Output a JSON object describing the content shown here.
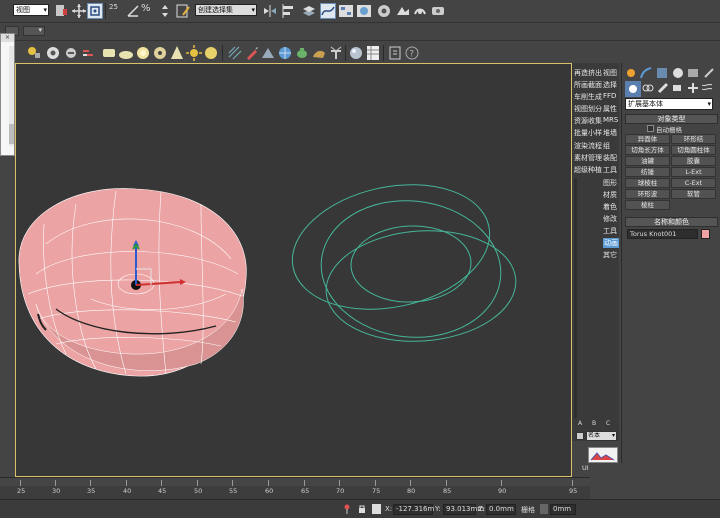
{
  "toolbar": {
    "view_dropdown": "视图",
    "selection_set": "创建选择集",
    "small_num": "25"
  },
  "scene_list": {
    "col1": [
      "再造挤出",
      "所画截面",
      "车削生成",
      "视图划分",
      "资源收集",
      "批量小样",
      "渲染流程",
      "素材管理",
      "超级种植"
    ],
    "col2": [
      "视图",
      "选择",
      "FFD",
      "属性",
      "MRS",
      "堆墙",
      "组",
      "装配",
      "工具"
    ],
    "col3": [
      "图形",
      "材质",
      "着色",
      "修改",
      "工具",
      "动画",
      "其它"
    ],
    "bottom_tabs": [
      "A",
      "B",
      "C"
    ],
    "bottom_dd": "名本",
    "bottom_label": "UI"
  },
  "command_panel": {
    "category_dropdown": "扩展基本体",
    "object_type_title": "对象类型",
    "autogrid": "自动栅格",
    "buttons": [
      "异面体",
      "环形结",
      "切角长方体",
      "切角圆柱体",
      "油罐",
      "胶囊",
      "纺锤",
      "L-Ext",
      "球棱柱",
      "C-Ext",
      "环形波",
      "软管",
      "棱柱"
    ],
    "name_color_title": "名称和颜色",
    "object_name": "Torus Knot001",
    "object_color": "#f0a2a2"
  },
  "timeline": {
    "ticks": [
      "25",
      "30",
      "35",
      "40",
      "45",
      "50",
      "55",
      "60",
      "65",
      "70",
      "75",
      "80",
      "85",
      "90",
      "95"
    ]
  },
  "status": {
    "x_label": "X:",
    "x_value": "-127.316m",
    "y_label": "Y:",
    "y_value": "93.013mm",
    "z_label": "Z:",
    "z_value": "0.0mm",
    "grid_label": "栅格",
    "grid_value": "0mm"
  },
  "colors": {
    "knot_fill": "#eba3a3",
    "wire": "#46b69a",
    "viewport_border": "#d8c36a",
    "active_item": "#5b9bd5"
  }
}
